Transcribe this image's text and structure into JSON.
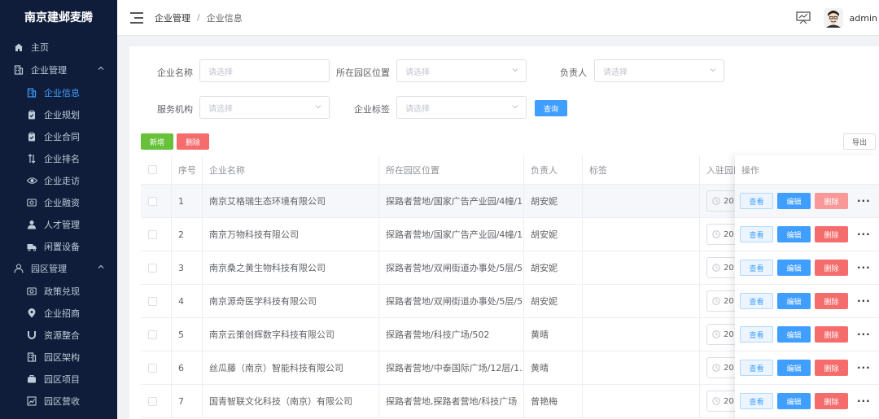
{
  "sidebar": {
    "brand": "南京建邺麦腾",
    "items": [
      {
        "label": "主页",
        "icon": "home-icon",
        "type": "top"
      },
      {
        "label": "企业管理",
        "icon": "building-icon",
        "type": "group"
      },
      {
        "label": "企业信息",
        "icon": "building-icon",
        "type": "sub",
        "active": true
      },
      {
        "label": "企业规划",
        "icon": "clipboard-icon",
        "type": "sub"
      },
      {
        "label": "企业合同",
        "icon": "clipboard-icon",
        "type": "sub"
      },
      {
        "label": "企业排名",
        "icon": "sort-icon",
        "type": "sub"
      },
      {
        "label": "企业走访",
        "icon": "eye-icon",
        "type": "sub"
      },
      {
        "label": "企业融资",
        "icon": "money-icon",
        "type": "sub"
      },
      {
        "label": "人才管理",
        "icon": "user-icon",
        "type": "sub"
      },
      {
        "label": "闲置设备",
        "icon": "truck-icon",
        "type": "sub"
      },
      {
        "label": "园区管理",
        "icon": "person-outline-icon",
        "type": "group"
      },
      {
        "label": "政策兑现",
        "icon": "money-icon",
        "type": "sub"
      },
      {
        "label": "企业招商",
        "icon": "location-icon",
        "type": "sub"
      },
      {
        "label": "资源整合",
        "icon": "magnet-icon",
        "type": "sub"
      },
      {
        "label": "园区架构",
        "icon": "building-icon",
        "type": "sub"
      },
      {
        "label": "园区项目",
        "icon": "briefcase-icon",
        "type": "sub"
      },
      {
        "label": "园区营收",
        "icon": "chart-icon",
        "type": "sub"
      }
    ]
  },
  "header": {
    "breadcrumb": [
      "企业管理",
      "企业信息"
    ],
    "username": "admin"
  },
  "filters": {
    "company_name_label": "企业名称",
    "company_name_placeholder": "请选择",
    "location_label": "所在园区位置",
    "location_placeholder": "请选择",
    "owner_label": "负责人",
    "owner_placeholder": "请选择",
    "service_label": "服务机构",
    "service_placeholder": "请选择",
    "tag_label": "企业标签",
    "tag_placeholder": "请选择",
    "query_button": "查询"
  },
  "toolbar": {
    "add_button": "新增",
    "delete_button": "删除",
    "export_button": "导出"
  },
  "table": {
    "headers": {
      "index": "序号",
      "name": "企业名称",
      "location": "所在园区位置",
      "owner": "负责人",
      "tag": "标签",
      "date": "入驻园区",
      "ops": "操作"
    },
    "date_prefix": "20",
    "op_labels": {
      "view": "查看",
      "edit": "编辑",
      "delete": "删除",
      "more": "···"
    },
    "rows": [
      {
        "index": "1",
        "name": "南京艾格瑞生态环境有限公司",
        "location": "探路者营地/国家广告产业园/4幢/1...",
        "owner": "胡安妮",
        "tag": ""
      },
      {
        "index": "2",
        "name": "南京万物科技有限公司",
        "location": "探路者营地/国家广告产业园/4幢/1...",
        "owner": "胡安妮",
        "tag": ""
      },
      {
        "index": "3",
        "name": "南京桑之黄生物科技有限公司",
        "location": "探路者营地/双闸街道办事处/5层/5...",
        "owner": "胡安妮",
        "tag": ""
      },
      {
        "index": "4",
        "name": "南京源奇医学科技有限公司",
        "location": "探路者营地/双闸街道办事处/5层/5...",
        "owner": "胡安妮",
        "tag": ""
      },
      {
        "index": "5",
        "name": "南京云策创辉数字科技有限公司",
        "location": "探路者营地/科技广场/502",
        "owner": "黄晴",
        "tag": ""
      },
      {
        "index": "6",
        "name": "丝瓜藤（南京）智能科技有限公司",
        "location": "探路者营地/中泰国际广场/12层/1...",
        "owner": "黄晴",
        "tag": ""
      },
      {
        "index": "7",
        "name": "国青智联文化科技（南京）有限公司",
        "location": "探路者营地,探路者营地/科技广场",
        "owner": "曾艳梅",
        "tag": ""
      }
    ]
  }
}
